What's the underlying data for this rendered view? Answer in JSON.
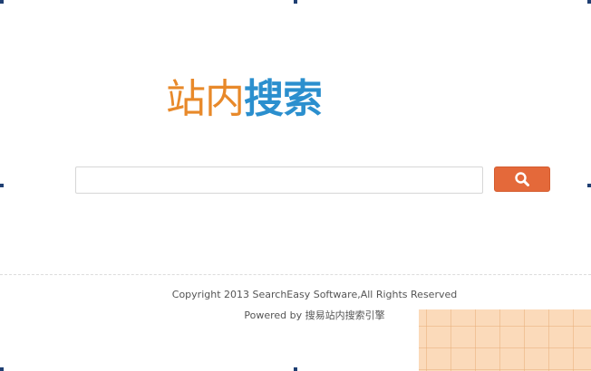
{
  "logo": {
    "part1": "站内",
    "part2": "搜索"
  },
  "search": {
    "value": "",
    "placeholder": ""
  },
  "footer": {
    "copyright": "Copyright 2013 SearchEasy Software,All Rights Reserved",
    "powered": "Powered by 搜易站内搜索引擎"
  },
  "icons": {
    "search_button_icon": "search-icon"
  },
  "colors": {
    "logo_orange": "#e8892a",
    "logo_blue": "#2b8fce",
    "search_button": "#e4693a",
    "overlay": "#fbd7b3"
  }
}
